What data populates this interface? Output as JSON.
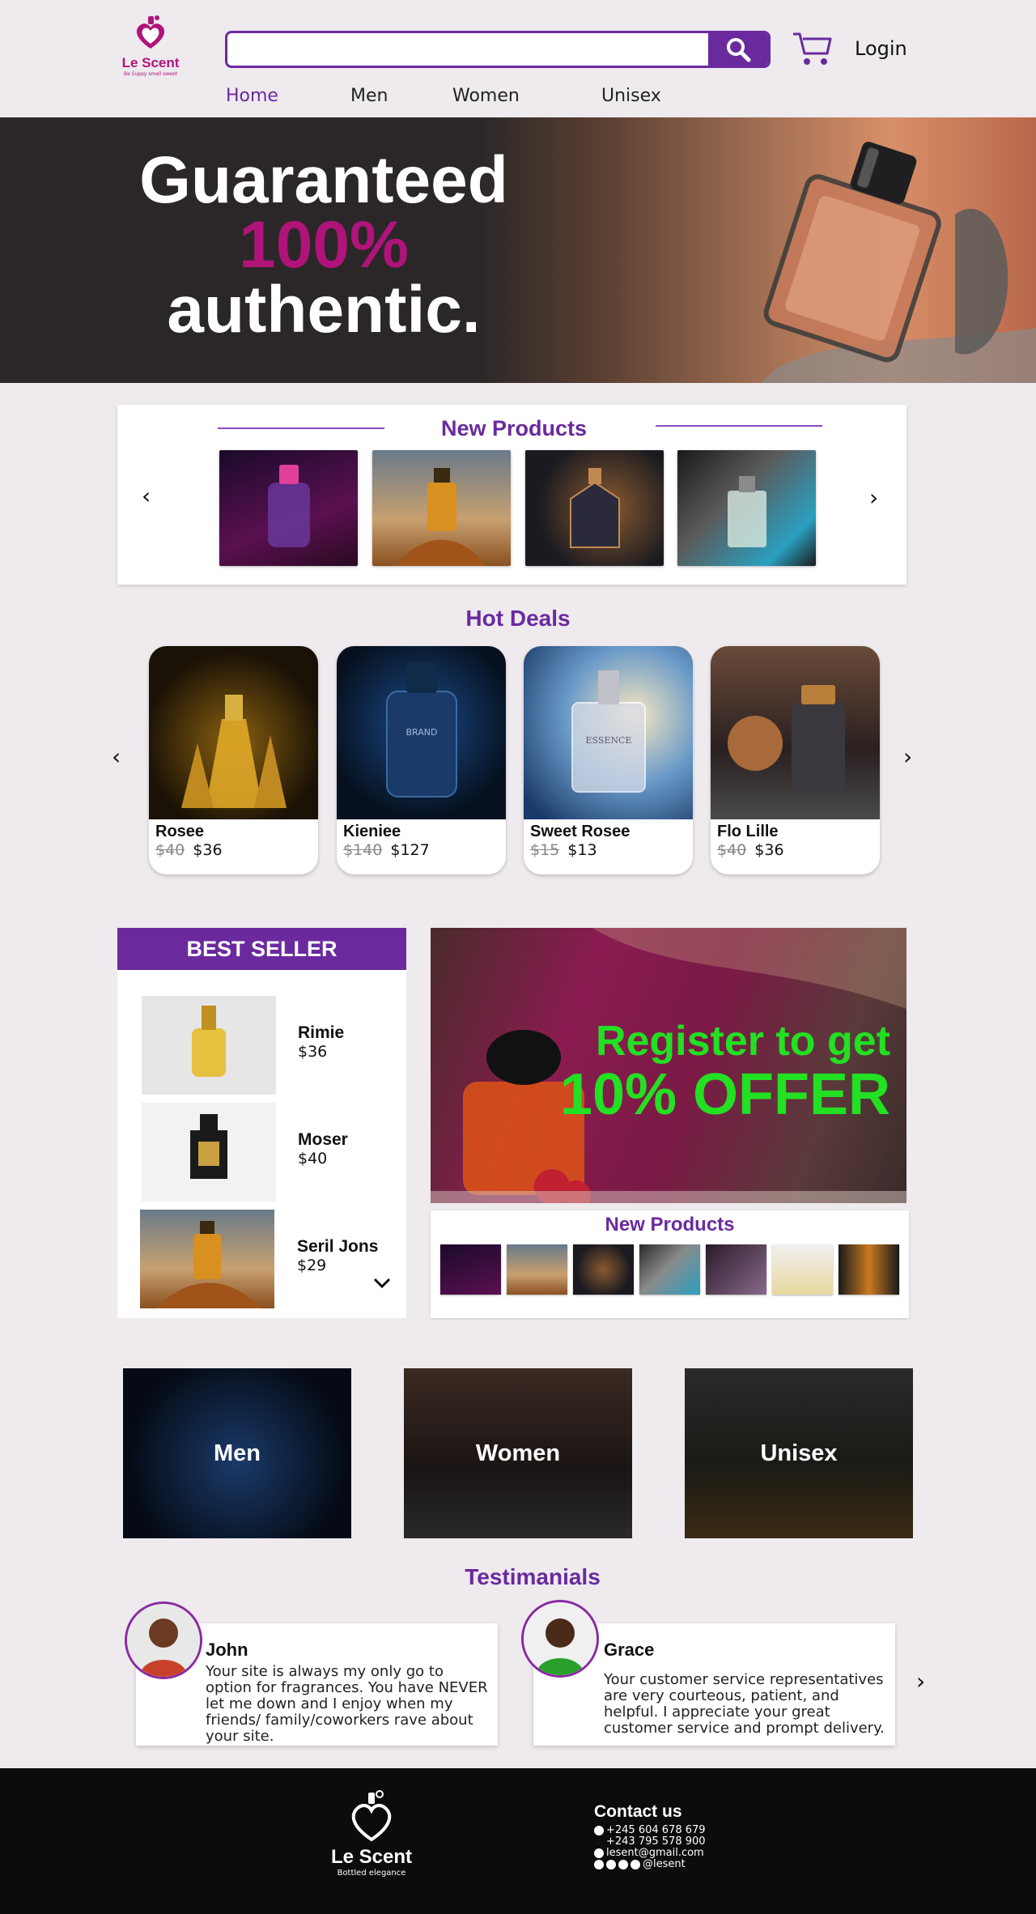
{
  "brand": {
    "name": "Le Scent",
    "tagline": "Be Suppy smell sweet",
    "footer_tagline": "Bottled elegance"
  },
  "header": {
    "search_placeholder": "",
    "login_label": "Login"
  },
  "nav": [
    {
      "label": "Home"
    },
    {
      "label": "Men"
    },
    {
      "label": "Women"
    },
    {
      "label": "Unisex"
    }
  ],
  "hero": {
    "line1": "Guaranteed",
    "line2": "100%",
    "line3": "authentic."
  },
  "new_products": {
    "title": "New Products",
    "prev": "‹",
    "next": "›"
  },
  "hot_deals": {
    "title": "Hot Deals",
    "items": [
      {
        "name": "Rosee",
        "old_price": "$40",
        "price": "$36"
      },
      {
        "name": "Kieniee",
        "old_price": "$140",
        "price": "$127"
      },
      {
        "name": "Sweet Rosee",
        "old_price": "$15",
        "price": "$13"
      },
      {
        "name": "Flo Lille",
        "old_price": "$40",
        "price": "$36"
      }
    ]
  },
  "best_seller": {
    "title": "BEST SELLER",
    "items": [
      {
        "name": "Rimie",
        "price": "$36"
      },
      {
        "name": "Moser",
        "price": "$40"
      },
      {
        "name": "Seril Jons",
        "price": "$29"
      }
    ]
  },
  "promo": {
    "line1": "Register to get",
    "line2": "10% OFFER"
  },
  "new_products_small": {
    "title": "New Products"
  },
  "categories": [
    {
      "label": "Men"
    },
    {
      "label": "Women"
    },
    {
      "label": "Unisex"
    }
  ],
  "testimonials": {
    "title": "Testimanials",
    "items": [
      {
        "name": "John",
        "text": "Your site is always my only go to option for fragrances. You have NEVER let me down and I enjoy when my friends/ family/coworkers rave about your site."
      },
      {
        "name": "Grace",
        "text": "Your customer service representatives are very courteous, patient, and helpful. I appreciate your great customer service and prompt delivery."
      }
    ]
  },
  "footer": {
    "contact_title": "Contact us",
    "phone1": "+245 604 678 679",
    "phone2": "+243 795 578 900",
    "email": "lesent@gmail.com",
    "social": "@lesent"
  },
  "colors": {
    "accent": "#6a2a9e",
    "brand_pink": "#b0137a",
    "promo_green": "#22e022",
    "footer_bg": "#0c0c0c"
  }
}
